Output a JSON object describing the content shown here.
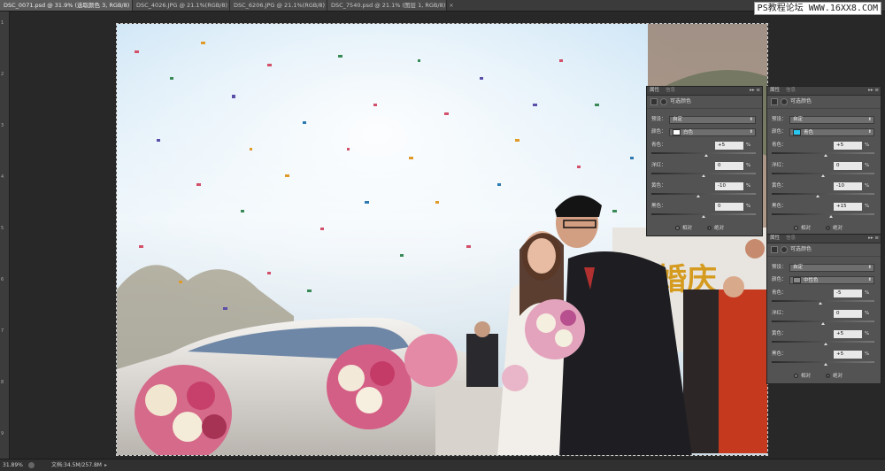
{
  "tabs": [
    {
      "label": "DSC_0071.psd @ 31.9% (选取颜色 3, RGB/8)",
      "active": true
    },
    {
      "label": "DSC_4026.JPG @ 21.1%(RGB/8)",
      "active": false
    },
    {
      "label": "DSC_6206.JPG @ 21.1%(RGB/8)",
      "active": false
    },
    {
      "label": "DSC_7540.psd @ 21.1% (图层 1, RGB/8)",
      "active": false
    }
  ],
  "tab_close": "×",
  "watermark": "PS教程论坛 WWW.16XX8.COM",
  "ruler_marks": [
    "1",
    "2",
    "3",
    "4",
    "5",
    "6",
    "7",
    "8",
    "9"
  ],
  "panels": [
    {
      "tab_active": "属性",
      "tab_inactive": "信息",
      "menu": "▸▸ ≡",
      "title": "可选颜色",
      "preset_label": "预设：",
      "preset_value": "自定",
      "color_label": "颜色：",
      "color_value": "白色",
      "color_swatch": "#ffffff",
      "sliders": [
        {
          "label": "青色：",
          "value": "+5",
          "level": 5
        },
        {
          "label": "洋红：",
          "value": "0",
          "level": 0
        },
        {
          "label": "黄色：",
          "value": "-10",
          "level": -10
        },
        {
          "label": "黑色：",
          "value": "0",
          "level": 0
        }
      ],
      "pct": "%",
      "radio_relative": "相对",
      "radio_absolute": "绝对",
      "selected": "absolute"
    },
    {
      "tab_active": "属性",
      "tab_inactive": "信息",
      "menu": "▸▸ ≡",
      "title": "可选颜色",
      "preset_label": "预设：",
      "preset_value": "自定",
      "color_label": "颜色：",
      "color_value": "青色",
      "color_swatch": "#29c6f0",
      "sliders": [
        {
          "label": "青色：",
          "value": "+5",
          "level": 5
        },
        {
          "label": "洋红：",
          "value": "0",
          "level": 0
        },
        {
          "label": "黄色：",
          "value": "-10",
          "level": -10
        },
        {
          "label": "黑色：",
          "value": "+15",
          "level": 15
        }
      ],
      "pct": "%",
      "radio_relative": "相对",
      "radio_absolute": "绝对",
      "selected": "absolute"
    },
    {
      "tab_active": "属性",
      "tab_inactive": "信息",
      "menu": "▸▸ ≡",
      "title": "可选颜色",
      "preset_label": "预设：",
      "preset_value": "自定",
      "color_label": "颜色：",
      "color_value": "中性色",
      "color_swatch": "#8a8a8a",
      "sliders": [
        {
          "label": "青色：",
          "value": "-5",
          "level": -5
        },
        {
          "label": "洋红：",
          "value": "0",
          "level": 0
        },
        {
          "label": "黄色：",
          "value": "+5",
          "level": 5
        },
        {
          "label": "黑色：",
          "value": "+5",
          "level": 5
        }
      ],
      "pct": "%",
      "radio_relative": "相对",
      "radio_absolute": "绝对",
      "selected": "absolute"
    }
  ],
  "status": {
    "zoom": "31.89%",
    "doc": "文档:34.5M/257.8M",
    "arrow": "▸"
  }
}
